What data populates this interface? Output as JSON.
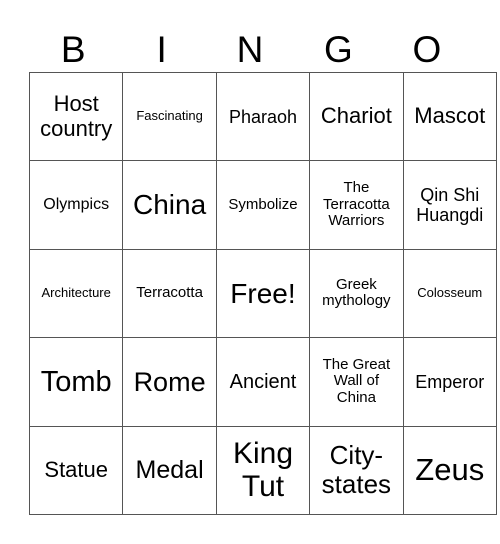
{
  "header": [
    "B",
    "I",
    "N",
    "G",
    "O"
  ],
  "rows": [
    [
      {
        "text": "Host country",
        "size": 22
      },
      {
        "text": "Fascinating",
        "size": 13
      },
      {
        "text": "Pharaoh",
        "size": 18
      },
      {
        "text": "Chariot",
        "size": 22
      },
      {
        "text": "Mascot",
        "size": 22
      }
    ],
    [
      {
        "text": "Olympics",
        "size": 16
      },
      {
        "text": "China",
        "size": 28
      },
      {
        "text": "Symbolize",
        "size": 15
      },
      {
        "text": "The Terracotta Warriors",
        "size": 15
      },
      {
        "text": "Qin Shi Huangdi",
        "size": 18
      }
    ],
    [
      {
        "text": "Architecture",
        "size": 13
      },
      {
        "text": "Terracotta",
        "size": 15
      },
      {
        "text": "Free!",
        "size": 28
      },
      {
        "text": "Greek mythology",
        "size": 15
      },
      {
        "text": "Colosseum",
        "size": 13
      }
    ],
    [
      {
        "text": "Tomb",
        "size": 29
      },
      {
        "text": "Rome",
        "size": 27
      },
      {
        "text": "Ancient",
        "size": 20
      },
      {
        "text": "The Great Wall of China",
        "size": 15
      },
      {
        "text": "Emperor",
        "size": 18
      }
    ],
    [
      {
        "text": "Statue",
        "size": 22
      },
      {
        "text": "Medal",
        "size": 25
      },
      {
        "text": "King Tut",
        "size": 30
      },
      {
        "text": "City-states",
        "size": 26
      },
      {
        "text": "Zeus",
        "size": 31
      }
    ]
  ]
}
